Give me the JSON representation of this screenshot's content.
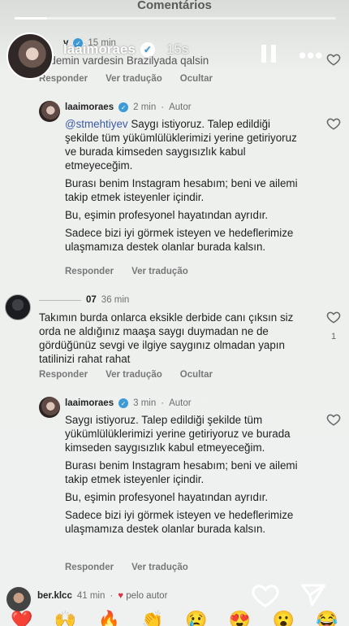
{
  "sheet": {
    "title": "Comentários"
  },
  "story": {
    "username": "laaimoraes",
    "time": "15s",
    "progress": 0.1
  },
  "comments": [
    {
      "user": "v",
      "time": "15 min",
      "text": "Erdemin vardesin Brazilyada qalsin",
      "actions": [
        "Responder",
        "Ver tradução",
        "Ocultar"
      ]
    },
    {
      "user": "laaimoraes",
      "time": "2 min",
      "tag": "Autor",
      "mention": "@stmehtiyev",
      "paragraphs": [
        " Saygı istiyoruz. Talep edildiği şekilde tüm yükümlülüklerimizi yerine getiriyoruz ve burada kimseden saygısızlık kabul etmeyeceğim.",
        "Burası benim Instagram hesabım; beni ve ailemi takip etmek isteyenler içindir.",
        "Bu, eşimin profesyonel hayatından ayrıdır.",
        "Sadece bizi iyi görmek isteyen ve hedeflerimize ulaşmamıza destek olanlar burada kalsın."
      ],
      "actions": [
        "Responder",
        "Ver tradução"
      ]
    },
    {
      "user": "07",
      "time": "36 min",
      "text": "Takımın burda onlarca eksikle derbide canı çıksın siz orda ne aldığınız maaşa saygı duymadan ne de gördüğünüz sevgi ve ilgiye saygınız olmadan yapın tatilinizi rahat rahat",
      "likes": "1",
      "actions": [
        "Responder",
        "Ver tradução",
        "Ocultar"
      ]
    },
    {
      "user": "laaimoraes",
      "time": "3 min",
      "tag": "Autor",
      "paragraphs": [
        "Saygı istiyoruz. Talep edildiği şekilde tüm yükümlülüklerimizi yerine getiriyoruz ve burada kimseden saygısızlık kabul etmeyeceğim.",
        "Burası benim Instagram hesabım; beni ve ailemi takip etmek isteyenler içindir.",
        "Bu, eşimin profesyonel hayatından ayrıdır.",
        "Sadece bizi iyi görmek isteyen ve hedeflerimize ulaşmamıza destek olanlar burada kalsın."
      ],
      "actions": [
        "Responder",
        "Ver tradução"
      ]
    },
    {
      "user": "ber.klcc",
      "time": "41 min",
      "liked_by": "pelo autor"
    }
  ],
  "colors": {
    "accent": "#3d9ad5",
    "mention": "#3c5ba6",
    "like": "#d8334a"
  },
  "icons": [
    "pause-icon",
    "more-icon",
    "heart-icon",
    "share-heart-icon",
    "send-icon",
    "verified-icon"
  ]
}
